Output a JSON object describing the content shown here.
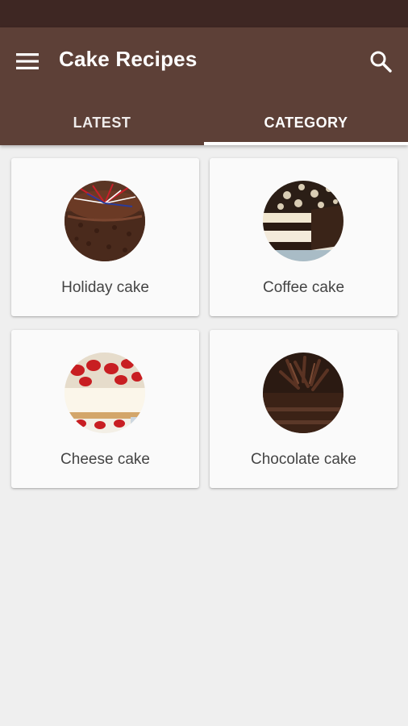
{
  "app": {
    "title": "Cake Recipes",
    "colors": {
      "status_bar": "#3e2723",
      "app_bar": "#5d4037",
      "background": "#efefef",
      "card": "#fafafa",
      "text": "#444444"
    }
  },
  "toolbar": {
    "menu_icon": "hamburger-menu-icon",
    "search_icon": "search-icon"
  },
  "tabs": [
    {
      "label": "LATEST",
      "selected": false
    },
    {
      "label": "CATEGORY",
      "selected": true
    }
  ],
  "categories": [
    {
      "label": "Holiday cake",
      "image": "holiday-cake-image"
    },
    {
      "label": "Coffee cake",
      "image": "coffee-cake-image"
    },
    {
      "label": "Cheese cake",
      "image": "cheese-cake-image"
    },
    {
      "label": "Chocolate cake",
      "image": "chocolate-cake-image"
    }
  ]
}
